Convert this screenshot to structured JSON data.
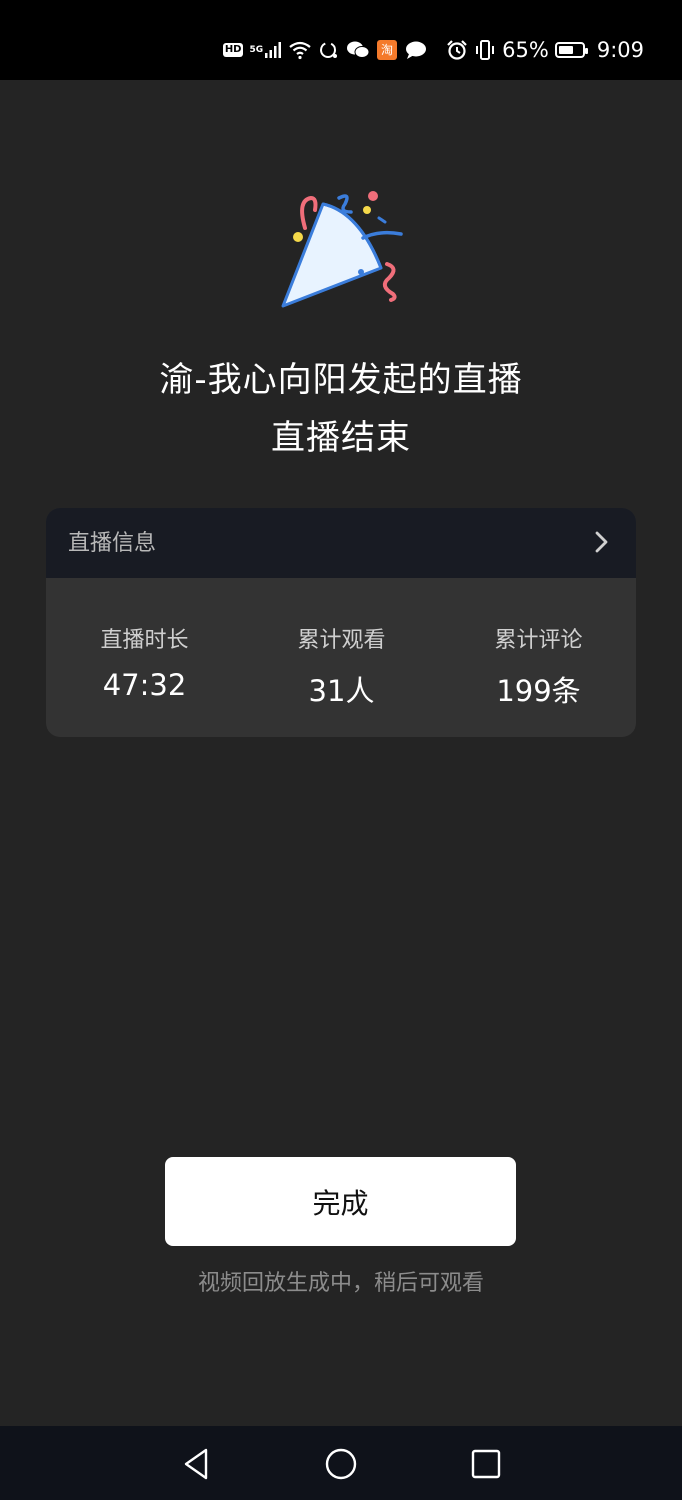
{
  "status_bar": {
    "hd": "HD",
    "network": "5G",
    "battery_percent_text": "65%",
    "battery_level": 0.65,
    "time": "9:09",
    "icons": [
      "hd-icon",
      "signal-icon",
      "wifi-icon",
      "sync-icon",
      "wechat-icon",
      "taobao-icon",
      "message-icon",
      "alarm-icon",
      "vibrate-icon",
      "battery-icon"
    ]
  },
  "header": {
    "title": "渝-我心向阳发起的直播",
    "subtitle": "直播结束"
  },
  "info_card": {
    "header_label": "直播信息",
    "stats": [
      {
        "label": "直播时长",
        "value": "47:32"
      },
      {
        "label": "累计观看",
        "value": "31人"
      },
      {
        "label": "累计评论",
        "value": "199条"
      }
    ]
  },
  "actions": {
    "done_label": "完成",
    "hint": "视频回放生成中，稍后可观看"
  },
  "nav": {
    "icons": [
      "back-icon",
      "home-icon",
      "recents-icon"
    ]
  },
  "colors": {
    "background": "#242424",
    "card": "#333333",
    "card_header": "#181b23",
    "button": "#ffffff",
    "confetti_blue": "#3b7ddb",
    "confetti_pink": "#f06e7a",
    "confetti_yellow": "#f5d94a"
  }
}
